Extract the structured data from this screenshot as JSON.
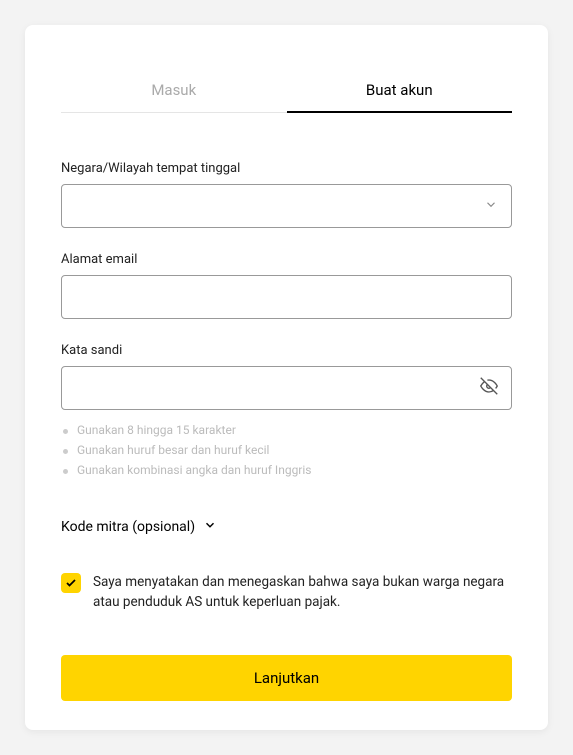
{
  "tabs": {
    "login": "Masuk",
    "signup": "Buat akun"
  },
  "fields": {
    "country_label": "Negara/Wilayah tempat tinggal",
    "email_label": "Alamat email",
    "password_label": "Kata sandi"
  },
  "hints": {
    "h1": "Gunakan 8 hingga 15 karakter",
    "h2": "Gunakan huruf besar dan huruf kecil",
    "h3": "Gunakan kombinasi angka dan huruf Inggris"
  },
  "partner_code": "Kode mitra (opsional)",
  "agreement": "Saya menyatakan dan menegaskan bahwa saya bukan warga negara atau penduduk AS untuk keperluan pajak.",
  "submit": "Lanjutkan"
}
